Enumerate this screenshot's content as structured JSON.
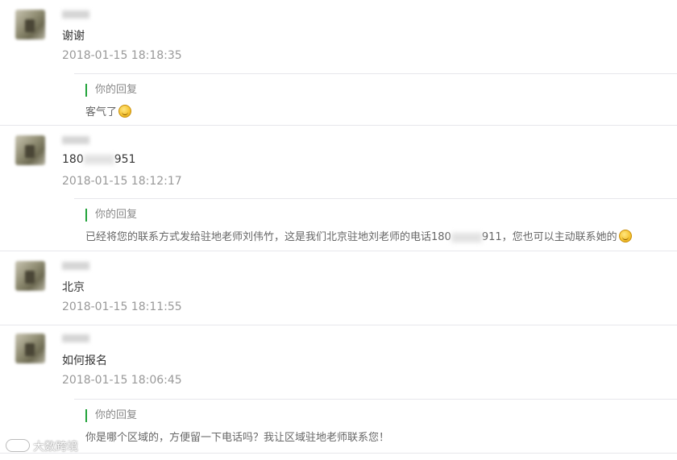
{
  "comments": [
    {
      "content": "谢谢",
      "time": "2018-01-15 18:18:35",
      "reply": {
        "label": "你的回复",
        "text": "客气了"
      }
    },
    {
      "content_prefix": "180",
      "content_suffix": "951",
      "time": "2018-01-15 18:12:17",
      "reply": {
        "label": "你的回复",
        "text_prefix": "已经将您的联系方式发给驻地老师刘伟竹，这是我们北京驻地刘老师的电话180",
        "text_suffix": "911，您也可以主动联系她的"
      }
    },
    {
      "content": "北京",
      "time": "2018-01-15 18:11:55"
    },
    {
      "content": "如何报名",
      "time": "2018-01-15 18:06:45",
      "reply": {
        "label": "你的回复",
        "text": "你是哪个区域的，方便留一下电话吗？我让区域驻地老师联系您！"
      }
    }
  ],
  "watermark": "大数跨境",
  "icons": [
    "smile-emoji-icon",
    "avatar"
  ],
  "colors": {
    "reply_bar": "#21a33a",
    "divider": "#e7e7eb",
    "time": "#999999"
  }
}
